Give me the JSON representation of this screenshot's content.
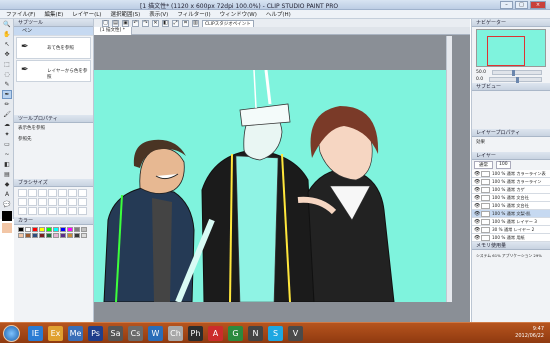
{
  "window": {
    "title": "[1 描文性* (1120 x 600px 72dpi 100.0%) - CLIP STUDIO PAINT PRO"
  },
  "menu": [
    "ファイル(F)",
    "編集(E)",
    "レイヤー(L)",
    "選択範囲(S)",
    "表示(V)",
    "フィルター(I)",
    "ウィンドウ(W)",
    "ヘルプ(H)"
  ],
  "toolbar": {
    "tag": "CLIPスタジオペイント"
  },
  "tab": {
    "label": "[1 描文性] *"
  },
  "subtool": {
    "header": "サブツール",
    "tab": "ペン",
    "item1": "あて色を参照",
    "item2": "レイヤーから色を参照"
  },
  "toolprop": {
    "header": "ツールプロパティ",
    "name": "表示色を参照",
    "ref": "参照先"
  },
  "brushsize": {
    "header": "ブラシサイズ"
  },
  "color": {
    "header": "カラー",
    "swatches": [
      "#000000",
      "#ffffff",
      "#ff0000",
      "#ffff00",
      "#00ff00",
      "#00ffff",
      "#0000ff",
      "#ff00ff",
      "#808080",
      "#c0c0c0",
      "#f2c6a6",
      "#9c5a2e",
      "#2f4f7f",
      "#7a1f1f",
      "#1f6b3a",
      "#e4b2d2",
      "#5a2e8a",
      "#c88c3a",
      "#3a3a3a",
      "#dcdcdc"
    ]
  },
  "navigator": {
    "header": "ナビゲーター",
    "zoom": "50.0",
    "angle": "0.0"
  },
  "subview": {
    "header": "サブビュー"
  },
  "layerprop": {
    "header": "レイヤープロパティ",
    "effect": "効果"
  },
  "layers": {
    "header": "レイヤー",
    "mode": "通常",
    "opacity": "100",
    "items": [
      {
        "label": "100 % 通常 カラーライン表",
        "sel": false
      },
      {
        "label": "100 % 通常 カラーライン",
        "sel": false
      },
      {
        "label": "100 % 通常 カゲ",
        "sel": false
      },
      {
        "label": "100 % 通常 文台社",
        "sel": false
      },
      {
        "label": "100 % 通常 文台社",
        "sel": false
      },
      {
        "label": "100 % 通常 文梨-肌",
        "sel": true
      },
      {
        "label": "100 % 通常 レイヤー 3",
        "sel": false
      },
      {
        "label": "30 % 通常 レイヤー 2",
        "sel": false
      },
      {
        "label": "100 % 通常 用紙",
        "sel": false
      }
    ]
  },
  "memory": {
    "header": "メモリ使用量",
    "text": "システム 61%  アプリケーション 29%"
  },
  "taskbar": {
    "icons": [
      "IE",
      "Ex",
      "Me",
      "Ps",
      "Sa",
      "Cs",
      "W",
      "Ch",
      "Ph",
      "A",
      "G",
      "N",
      "S",
      "V"
    ],
    "icon_colors": [
      "#2a7bd3",
      "#e0a030",
      "#3a6fb8",
      "#1f3e8a",
      "#555555",
      "#6b6b6b",
      "#2a6db8",
      "#a8a8a8",
      "#2c2c2c",
      "#cc2b2b",
      "#2b8a3e",
      "#444444",
      "#1ea7e1",
      "#4a4a4a"
    ],
    "time": "9:47",
    "date": "2012/06/22"
  }
}
